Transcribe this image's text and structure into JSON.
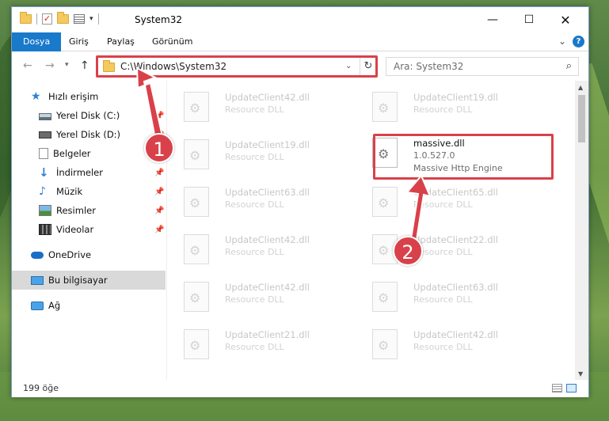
{
  "window": {
    "title": "System32",
    "controls": {
      "minimize": "—",
      "maximize": "☐",
      "close": "✕"
    }
  },
  "ribbon": {
    "tabs": [
      "Dosya",
      "Giriş",
      "Paylaş",
      "Görünüm"
    ],
    "help": "?"
  },
  "address_bar": {
    "path": "C:\\Windows\\System32",
    "refresh_icon": "refresh-icon"
  },
  "search": {
    "placeholder": "Ara: System32"
  },
  "sidebar": {
    "items": [
      {
        "label": "Hızlı erişim",
        "icon": "star-icon"
      },
      {
        "label": "Yerel Disk (C:)",
        "icon": "drive-icon",
        "pinned": true
      },
      {
        "label": "Yerel Disk (D:)",
        "icon": "drive-icon",
        "pinned": true
      },
      {
        "label": "Belgeler",
        "icon": "documents-icon",
        "pinned": true
      },
      {
        "label": "İndirmeler",
        "icon": "download-icon",
        "pinned": true
      },
      {
        "label": "Müzik",
        "icon": "music-icon",
        "pinned": true
      },
      {
        "label": "Resimler",
        "icon": "pictures-icon",
        "pinned": true
      },
      {
        "label": "Videolar",
        "icon": "videos-icon",
        "pinned": true
      },
      {
        "label": "OneDrive",
        "icon": "cloud-icon"
      },
      {
        "label": "Bu bilgisayar",
        "icon": "computer-icon",
        "selected": true
      },
      {
        "label": "Ağ",
        "icon": "network-icon"
      }
    ]
  },
  "files": [
    {
      "name": "UpdateClient42.dll",
      "desc": "Resource DLL"
    },
    {
      "name": "UpdateClient19.dll",
      "desc": "Resource DLL"
    },
    {
      "name": "UpdateClient19.dll",
      "desc": "Resource DLL"
    },
    {
      "name": "massive.dll",
      "version": "1.0.527.0",
      "desc": "Massive Http Engine",
      "focused": true
    },
    {
      "name": "UpdateClient63.dll",
      "desc": "Resource DLL"
    },
    {
      "name": "UpdateClient65.dll",
      "desc": "Resource DLL"
    },
    {
      "name": "UpdateClient42.dll",
      "desc": "Resource DLL"
    },
    {
      "name": "UpdateClient22.dll",
      "desc": "Resource DLL"
    },
    {
      "name": "UpdateClient42.dll",
      "desc": "Resource DLL"
    },
    {
      "name": "UpdateClient63.dll",
      "desc": "Resource DLL"
    },
    {
      "name": "UpdateClient21.dll",
      "desc": "Resource DLL"
    },
    {
      "name": "UpdateClient42.dll",
      "desc": "Resource DLL"
    }
  ],
  "status": {
    "item_count": "199 öğe"
  },
  "annotations": {
    "callout1": "1",
    "callout2": "2",
    "color": "#d9414a"
  }
}
